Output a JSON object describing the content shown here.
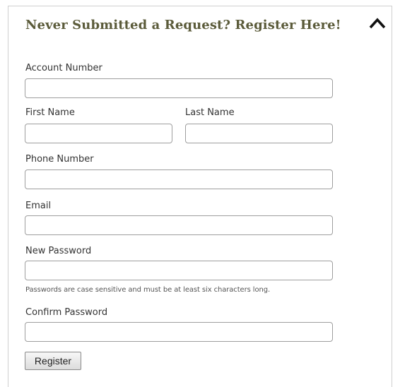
{
  "form": {
    "title": "Never Submitted a Request? Register Here!",
    "collapse_icon": "chevron-up-icon",
    "fields": {
      "account_number": {
        "label": "Account Number",
        "value": "",
        "placeholder": ""
      },
      "first_name": {
        "label": "First Name",
        "value": "",
        "placeholder": ""
      },
      "last_name": {
        "label": "Last Name",
        "value": "",
        "placeholder": ""
      },
      "phone_number": {
        "label": "Phone Number",
        "value": "",
        "placeholder": ""
      },
      "email": {
        "label": "Email",
        "value": "",
        "placeholder": ""
      },
      "new_password": {
        "label": "New Password",
        "value": "",
        "placeholder": ""
      },
      "confirm_password": {
        "label": "Confirm Password",
        "value": "",
        "placeholder": ""
      }
    },
    "password_hint": "Passwords are case sensitive and must be at least six characters long.",
    "register_label": "Register",
    "title_color": "#5b5b3a"
  }
}
